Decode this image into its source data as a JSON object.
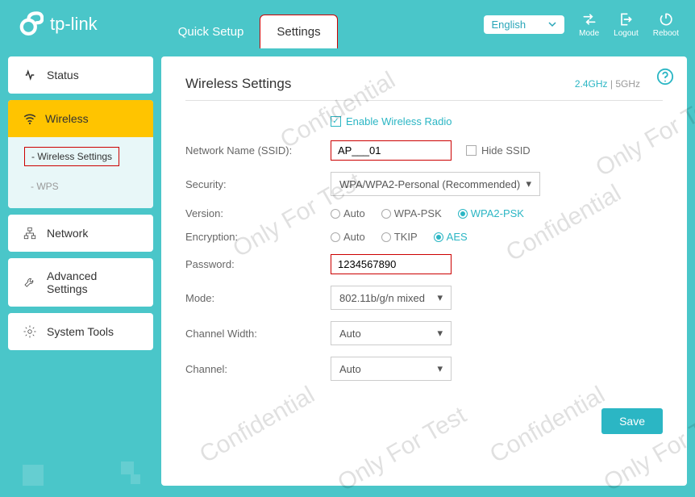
{
  "brand": "tp-link",
  "tabs": {
    "quick_setup": "Quick Setup",
    "settings": "Settings"
  },
  "header": {
    "lang": "English",
    "mode": "Mode",
    "logout": "Logout",
    "reboot": "Reboot"
  },
  "nav": {
    "status": "Status",
    "wireless": "Wireless",
    "wireless_sub": {
      "settings": "Wireless Settings",
      "wps": "WPS"
    },
    "network": "Network",
    "advanced": "Advanced Settings",
    "system": "System Tools"
  },
  "panel": {
    "title": "Wireless Settings",
    "band24": "2.4GHz",
    "bandsep": "|",
    "band5": "5GHz",
    "enable_radio": "Enable Wireless Radio",
    "ssid_label": "Network Name (SSID):",
    "ssid_value": "AP___01",
    "hide_ssid": "Hide SSID",
    "security_label": "Security:",
    "security_value": "WPA/WPA2-Personal (Recommended)",
    "version_label": "Version:",
    "version_opts": {
      "auto": "Auto",
      "wpa": "WPA-PSK",
      "wpa2": "WPA2-PSK"
    },
    "encryption_label": "Encryption:",
    "encryption_opts": {
      "auto": "Auto",
      "tkip": "TKIP",
      "aes": "AES"
    },
    "password_label": "Password:",
    "password_value": "1234567890",
    "mode_label": "Mode:",
    "mode_value": "802.11b/g/n mixed",
    "chwidth_label": "Channel Width:",
    "chwidth_value": "Auto",
    "channel_label": "Channel:",
    "channel_value": "Auto",
    "save": "Save"
  },
  "watermark": {
    "conf": "Confidential",
    "test": "Only For Test"
  }
}
